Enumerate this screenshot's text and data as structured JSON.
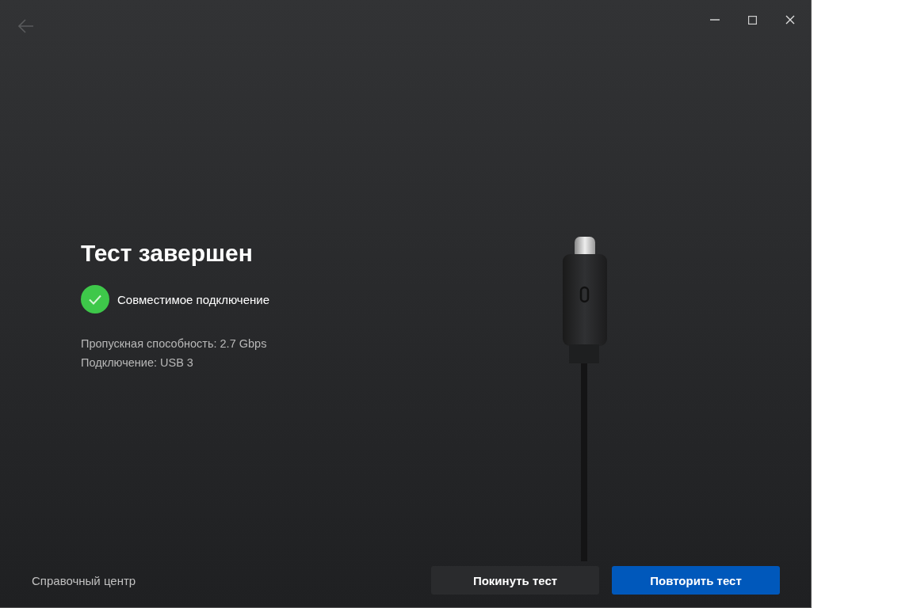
{
  "titlebar": {
    "back": {
      "disabled": true
    }
  },
  "result": {
    "title": "Тест завершен",
    "status": {
      "label": "Совместимое подключение",
      "passed": true
    },
    "details": [
      "Пропускная способность: 2.7 Gbps",
      "Подключение: USB 3"
    ]
  },
  "footer": {
    "help_link": "Справочный центр",
    "buttons": [
      {
        "label": "Покинуть тест",
        "kind": "secondary"
      },
      {
        "label": "Повторить тест",
        "kind": "primary"
      }
    ]
  }
}
